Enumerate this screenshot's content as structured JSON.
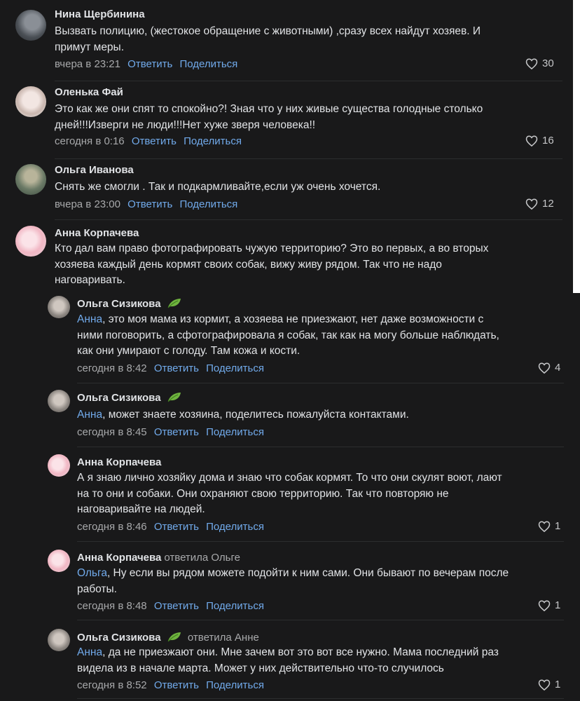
{
  "actions": {
    "reply": "Ответить",
    "share": "Поделиться"
  },
  "comments": [
    {
      "author": "Нина Щербинина",
      "text_lines": [
        "Вызвать полицию, (жестокое обращение с животными) ,сразу всех найдут хозяев. И",
        "примут меры."
      ],
      "time": "вчера в 23:21",
      "likes": "30"
    },
    {
      "author": "Оленька Фай",
      "text_lines": [
        "Это как же они спят то спокойно?! Зная что у них живые существа голодные столько",
        "дней!!!Изверги не люди!!!Нет хуже зверя человека!!"
      ],
      "time": "сегодня в 0:16",
      "likes": "16"
    },
    {
      "author": "Ольга Иванова",
      "text_lines": [
        "Снять же смогли . Так и подкармливайте,если уж очень хочется."
      ],
      "time": "вчера в 23:00",
      "likes": "12"
    },
    {
      "author": "Анна Корпачева",
      "text_lines": [
        "Кто дал вам право фотографировать чужую территорию? Это во первых, а во вторых",
        "хозяева каждый день кормят своих собак, вижу живу рядом. Так что не надо",
        "наговаривать."
      ]
    }
  ],
  "replies": [
    {
      "author": "Ольга Сизикова",
      "mention": "Анна",
      "text_lines": [
        ", это моя мама из кормит, а хозяева не приезжают, нет даже возможности с",
        "ними поговорить, а сфотографировала я собак, так как на могу больше наблюдать,",
        "как они умирают с голоду. Там кожа и кости."
      ],
      "time": "сегодня в 8:42",
      "likes": "4"
    },
    {
      "author": "Ольга Сизикова",
      "mention": "Анна",
      "text_lines": [
        ", может знаете хозяина, поделитесь пожалуйста контактами."
      ],
      "time": "сегодня в 8:45",
      "likes": ""
    },
    {
      "author": "Анна Корпачева",
      "mention": "",
      "text_lines": [
        "А я знаю лично хозяйку дома и знаю что собак кормят. То что они скулят воют, лают",
        "на то они и собаки. Они охраняют свою территорию. Так что повторяю не",
        "наговаривайте на людей."
      ],
      "time": "сегодня в 8:46",
      "likes": "1"
    },
    {
      "author": "Анна Корпачева",
      "replied_to": "ответила Ольге",
      "mention": "Ольга",
      "text_lines": [
        ", Ну если вы рядом можете подойти к ним сами. Они бывают по вечерам после",
        "работы."
      ],
      "time": "сегодня в 8:48",
      "likes": "1"
    },
    {
      "author": "Ольга Сизикова",
      "replied_to": "ответила Анне",
      "mention": "Анна",
      "text_lines": [
        ", да не приезжают они. Мне зачем вот это вот все нужно. Мама последний раз",
        "видела из в начале марта. Может у них действительно что-то случилось"
      ],
      "time": "сегодня в 8:52",
      "likes": "1"
    }
  ],
  "colors": {
    "background": "#19191a",
    "link": "#71aaeb",
    "secondary": "#a8a9ab",
    "leaf": "#6fb33f"
  }
}
